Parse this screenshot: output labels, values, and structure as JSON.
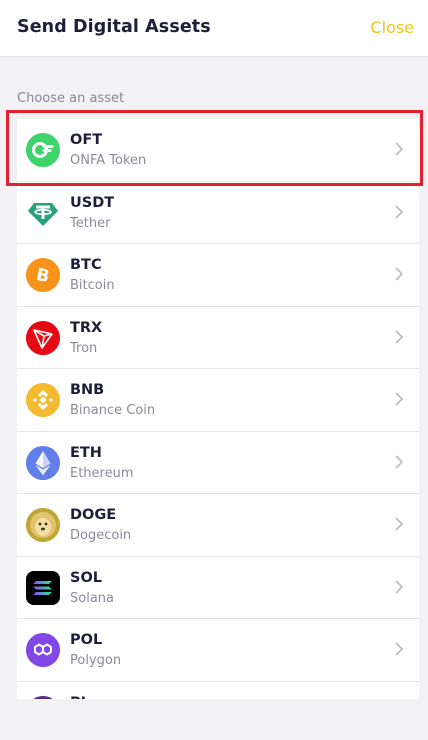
{
  "header": {
    "title": "Send Digital Assets",
    "close_label": "Close"
  },
  "section_label": "Choose an asset",
  "assets": [
    {
      "symbol": "OFT",
      "name": "ONFA Token",
      "icon": "onfa-token-icon",
      "color": "#3fd36b"
    },
    {
      "symbol": "USDT",
      "name": "Tether",
      "icon": "tether-icon",
      "color": "#26a17b"
    },
    {
      "symbol": "BTC",
      "name": "Bitcoin",
      "icon": "bitcoin-icon",
      "color": "#f7931a"
    },
    {
      "symbol": "TRX",
      "name": "Tron",
      "icon": "tron-icon",
      "color": "#e50914"
    },
    {
      "symbol": "BNB",
      "name": "Binance Coin",
      "icon": "binance-coin-icon",
      "color": "#f3ba2f"
    },
    {
      "symbol": "ETH",
      "name": "Ethereum",
      "icon": "ethereum-icon",
      "color": "#627eea"
    },
    {
      "symbol": "DOGE",
      "name": "Dogecoin",
      "icon": "dogecoin-icon",
      "color": "#c2a633"
    },
    {
      "symbol": "SOL",
      "name": "Solana",
      "icon": "solana-icon",
      "color": "#000000"
    },
    {
      "symbol": "POL",
      "name": "Polygon",
      "icon": "polygon-icon",
      "color": "#8247e5"
    },
    {
      "symbol": "PI",
      "name": "",
      "icon": "pi-icon",
      "color": "#5b2c83"
    }
  ],
  "accent_color": "#f0c419",
  "highlight_color": "#e3202b"
}
